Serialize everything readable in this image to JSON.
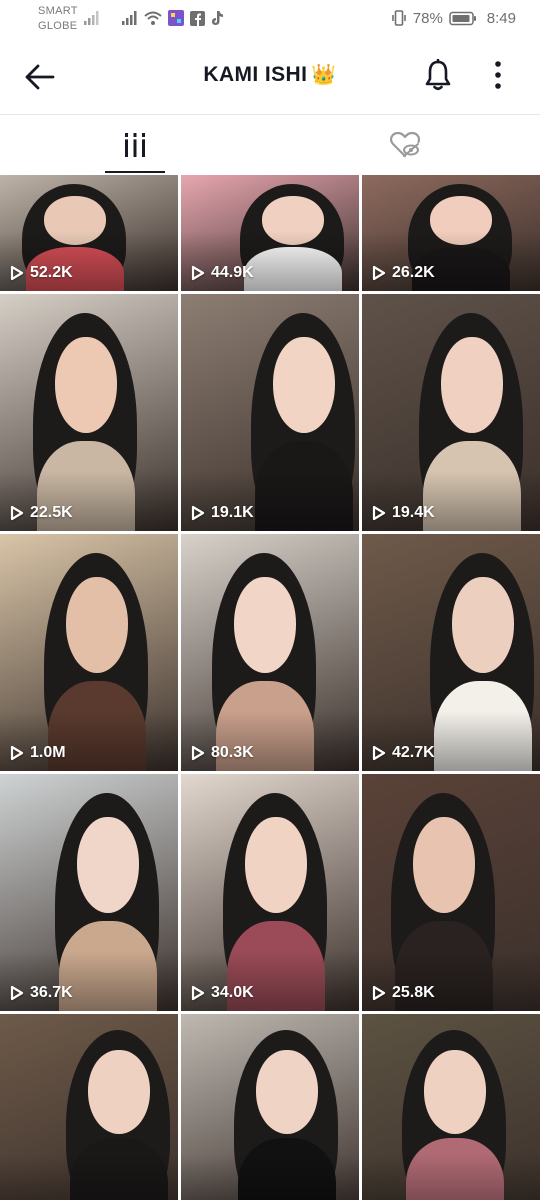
{
  "status_bar": {
    "carrier_line1": "SMART",
    "carrier_line2": "GLOBE",
    "battery": "78%",
    "time": "8:49",
    "icons": [
      "signal-icon",
      "signal-icon",
      "wifi-icon",
      "app-icon",
      "facebook-icon",
      "tiktok-icon",
      "vibrate-icon",
      "battery-icon"
    ]
  },
  "header": {
    "title": "KAMI ISHI",
    "crown": "👑",
    "icons": [
      "back-arrow-icon",
      "bell-icon",
      "more-vertical-icon"
    ]
  },
  "tabs": [
    {
      "name": "videos",
      "icon": "grid-icon",
      "active": true
    },
    {
      "name": "liked",
      "icon": "hidden-heart-icon",
      "active": false
    }
  ],
  "videos": [
    {
      "views": "52.2K",
      "bg": "#bdb3a8",
      "skin": "#e9c9b6",
      "top": "#d94f57"
    },
    {
      "views": "44.9K",
      "bg": "#e7a6b0",
      "skin": "#f0d0c0",
      "top": "#ffffff"
    },
    {
      "views": "26.2K",
      "bg": "#8e6a5e",
      "skin": "#f1cdbd",
      "top": "#1a1717"
    },
    {
      "views": "22.5K",
      "bg": "#d6cfc6",
      "skin": "#edc9b4",
      "top": "#c9b7a3"
    },
    {
      "views": "19.1K",
      "bg": "#8d7e73",
      "skin": "#f2d4c4",
      "top": "#1a1717"
    },
    {
      "views": "19.4K",
      "bg": "#5e5249",
      "skin": "#efd0c1",
      "top": "#d6c4b0"
    },
    {
      "views": "1.0M",
      "bg": "#d9c5a8",
      "skin": "#e4bfa7",
      "top": "#5a3a2e"
    },
    {
      "views": "80.3K",
      "bg": "#d8d2cb",
      "skin": "#f1d5c6",
      "top": "#c9a08c"
    },
    {
      "views": "42.7K",
      "bg": "#6f5a4a",
      "skin": "#edcfbf",
      "top": "#f3f0ea"
    },
    {
      "views": "36.7K",
      "bg": "#cfd3d4",
      "skin": "#f0d6c8",
      "top": "#caa88e"
    },
    {
      "views": "34.0K",
      "bg": "#e2d8cf",
      "skin": "#f0d3c3",
      "top": "#9a4b57"
    },
    {
      "views": "25.8K",
      "bg": "#5a4238",
      "skin": "#e7c3b0",
      "top": "#2a2220"
    },
    {
      "views": "",
      "bg": "#6e5a49",
      "skin": "#efd1c1",
      "top": "#1a1717"
    },
    {
      "views": "",
      "bg": "#bfb9b2",
      "skin": "#efd3c4",
      "top": "#111111"
    },
    {
      "views": "",
      "bg": "#5c5342",
      "skin": "#efd1c1",
      "top": "#b06a74"
    }
  ]
}
